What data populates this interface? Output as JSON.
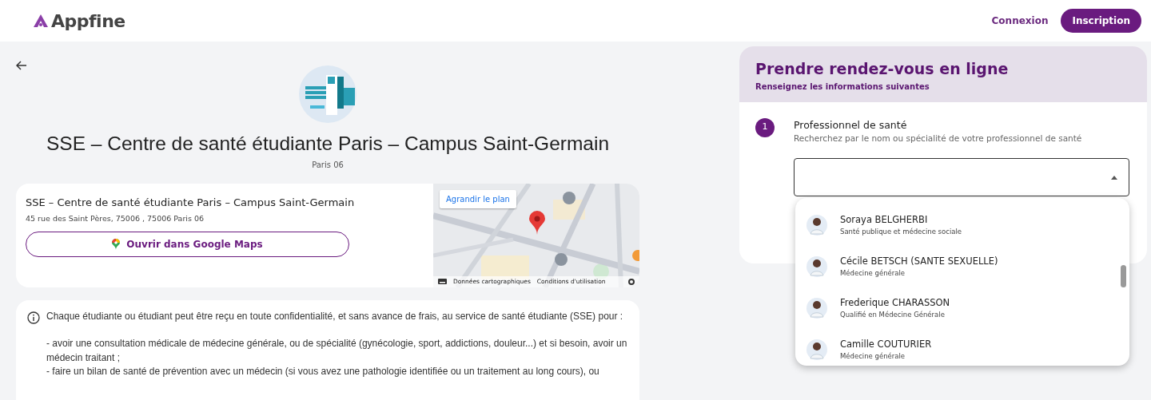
{
  "header": {
    "logo": "Appfine",
    "links": [
      {
        "label": "Connexion",
        "kind": "link"
      },
      {
        "label": "Inscription",
        "kind": "primary"
      }
    ]
  },
  "center": {
    "title": "SSE – Centre de santé étudiante Paris – Campus Saint-Germain",
    "city": "Paris 06"
  },
  "location_card": {
    "name": "SSE – Centre de santé étudiante Paris – Campus Saint-Germain",
    "address": "45 rue des Saint Pères, 75006 , 75006 Paris 06",
    "maps_button": "Ouvrir dans Google Maps",
    "map": {
      "enlarge_button": "Agrandir le plan",
      "attribution": "Données cartographiques",
      "terms": "Conditions d'utilisation"
    }
  },
  "info": {
    "paragraphs": [
      "Chaque étudiante ou étudiant peut être reçu en toute confidentialité, et sans avance de frais, au service de santé étudiante (SSE) pour :",
      "- avoir une consultation médicale de médecine générale, ou de spécialité (gynécologie, sport, addictions, douleur...) et si besoin, avoir un médecin traitant ;",
      "- faire un bilan de santé de prévention avec un médecin (si vous avez une pathologie identifiée ou un traitement au long cours), ou"
    ]
  },
  "booking": {
    "title": "Prendre rendez-vous en ligne",
    "subtitle": "Renseignez les informations suivantes",
    "step": {
      "number": "1",
      "title": "Professionnel de santé",
      "hint": "Recherchez par le nom ou spécialité de votre professionnel de santé"
    },
    "dropdown": {
      "expanded": true,
      "options": [
        {
          "name": "Soraya BELGHERBI",
          "specialty": "Santé publique et médecine sociale"
        },
        {
          "name": "Cécile BETSCH (SANTE SEXUELLE)",
          "specialty": "Médecine générale"
        },
        {
          "name": "Frederique CHARASSON",
          "specialty": "Qualifié en Médecine Générale"
        },
        {
          "name": "Camille COUTURIER",
          "specialty": "Médecine générale"
        }
      ]
    }
  }
}
